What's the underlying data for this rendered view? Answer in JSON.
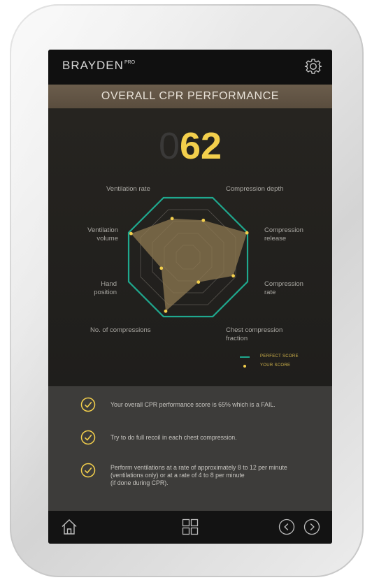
{
  "app": {
    "logo_text": "BRAYDEN",
    "logo_sup": "PRO"
  },
  "header": {
    "title": "OVERALL CPR PERFORMANCE"
  },
  "score": {
    "leading": "0",
    "value": "62"
  },
  "radar": {
    "labels": {
      "ventilation_rate": "Ventilation rate",
      "compression_depth": "Compression depth",
      "ventilation_volume_1": "Ventilation",
      "ventilation_volume_2": "volume",
      "compression_release_1": "Compression",
      "compression_release_2": "release",
      "hand_position_1": "Hand",
      "hand_position_2": "position",
      "compression_rate_1": "Compression",
      "compression_rate_2": "rate",
      "no_of_compressions": "No. of compressions",
      "chest_fraction_1": "Chest compression",
      "chest_fraction_2": "fraction"
    },
    "axes": [
      "Compression depth",
      "Compression release",
      "Compression rate",
      "Chest compression fraction",
      "No. of compressions",
      "Hand position",
      "Ventilation volume",
      "Ventilation rate"
    ],
    "your_score": [
      0.62,
      0.99,
      0.76,
      0.42,
      0.91,
      0.45,
      0.96,
      0.65
    ],
    "perfect_color": "#1fa88e",
    "score_color": "#f3cf4c",
    "fill_color": "#8a7650"
  },
  "legend": {
    "perfect": "PERFECT SCORE",
    "yours": "YOUR SCORE"
  },
  "feedback": {
    "items": [
      {
        "text": "Your overall CPR performance score is 65% which is a FAIL."
      },
      {
        "text": "Try to do full recoil in each chest compression."
      },
      {
        "text_1": "Perform ventilations at a rate of approximately 8 to 12 per minute",
        "text_2": "(ventilations only) or at a rate of 4 to 8 per minute",
        "text_3": "(if done during CPR)."
      }
    ]
  },
  "nav": {
    "home": "home-icon",
    "grid": "grid-icon",
    "prev": "chevron-left-icon",
    "next": "chevron-right-icon"
  }
}
